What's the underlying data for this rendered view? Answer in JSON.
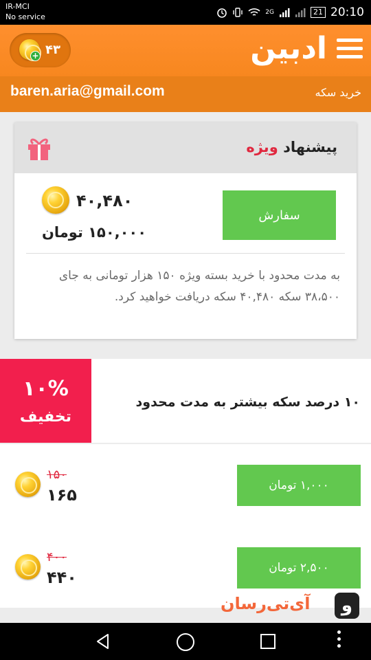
{
  "status_bar": {
    "carrier_line1": "IR-MCI",
    "carrier_line2": "No service",
    "network_type": "2G",
    "battery": "21",
    "time": "20:10"
  },
  "app_bar": {
    "logo_text": "ادبین",
    "coin_balance": "۴۳",
    "plus_symbol": "+"
  },
  "sub_bar": {
    "email": "baren.aria@gmail.com",
    "page_title": "خرید سکه"
  },
  "special_offer": {
    "title_prefix": "پیشنهاد",
    "title_accent": "ویژه",
    "coin_amount": "۴۰,۴۸۰",
    "price": "۱۵۰,۰۰۰ تومان",
    "order_label": "سفارش",
    "description": "به مدت محدود با خرید بسته ویژه ۱۵۰ هزار تومانی به جای ۳۸،۵۰۰ سکه ۴۰,۴۸۰ سکه دریافت خواهید کرد."
  },
  "promo": {
    "percent": "۱۰%",
    "off_label": "تخفیف",
    "text": "۱۰ درصد سکه بیشتر به مدت محدود"
  },
  "packages": [
    {
      "old_amount": "۱۵۰",
      "new_amount": "۱۶۵",
      "price_label": "۱,۰۰۰ تومان"
    },
    {
      "old_amount": "۴۰۰",
      "new_amount": "۴۴۰",
      "price_label": "۲,۵۰۰ تومان"
    }
  ],
  "watermark": {
    "text": "آی‌تی‌رسان",
    "mark": "و"
  },
  "colors": {
    "app_bar": "#f7871f",
    "sub_bar": "#e98019",
    "buy_button": "#62c84f",
    "promo_badge": "#f21f4d",
    "accent_red": "#e0283f"
  },
  "icons": [
    "menu-icon",
    "coin-icon",
    "plus-icon",
    "gift-icon",
    "back-icon",
    "home-icon",
    "recents-icon",
    "more-icon"
  ]
}
